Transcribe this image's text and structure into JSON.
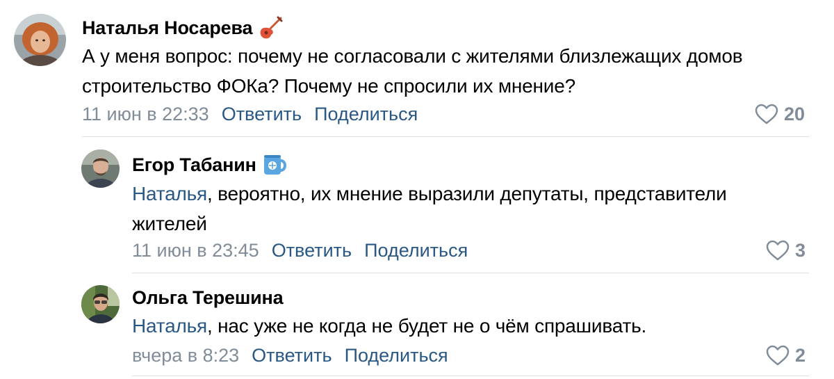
{
  "comments": [
    {
      "author": "Наталья Носарева",
      "badge_icon": "guitar-icon",
      "text": "А у меня вопрос: почему не согласовали с жителями близлежащих домов строительство ФОКа? Почему не спросили их мнение?",
      "date": "11 июн в 22:33",
      "reply_label": "Ответить",
      "share_label": "Поделиться",
      "likes": "20"
    },
    {
      "author": "Егор Табанин",
      "badge_icon": "mug-icon",
      "mention": "Наталья",
      "text": ", вероятно, их мнение выразили депутаты, представители жителей",
      "date": "11 июн в 23:45",
      "reply_label": "Ответить",
      "share_label": "Поделиться",
      "likes": "3"
    },
    {
      "author": "Ольга Терешина",
      "mention": "Наталья",
      "text": ", нас уже не когда не будет не о чём спрашивать.",
      "date": "вчера в 8:23",
      "reply_label": "Ответить",
      "share_label": "Поделиться",
      "likes": "2"
    }
  ],
  "colors": {
    "link": "#2a5885",
    "secondary": "#818c99",
    "divider": "#dce1e6"
  }
}
